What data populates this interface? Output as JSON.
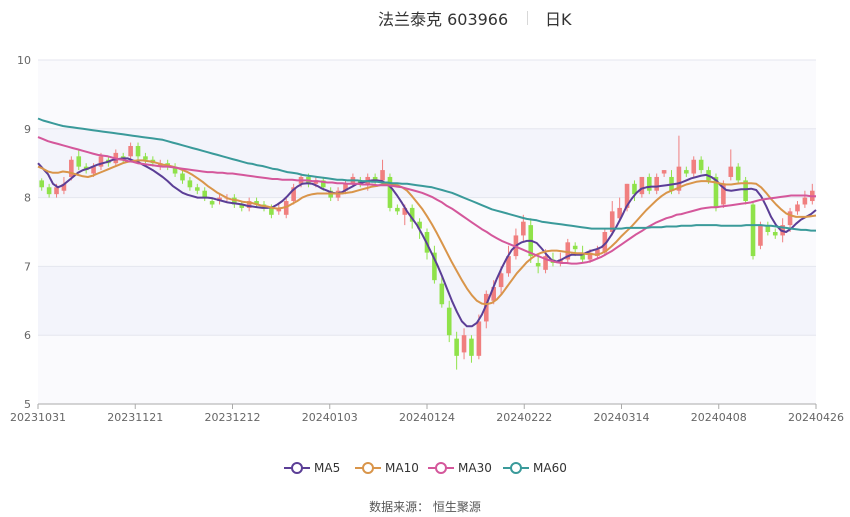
{
  "header": {
    "name": "法兰泰克 603966",
    "period": "日K"
  },
  "source": {
    "label": "数据来源：",
    "value": "恒生聚源"
  },
  "legend": [
    {
      "key": "ma5",
      "label": "MA5",
      "color": "#5b3e96"
    },
    {
      "key": "ma10",
      "label": "MA10",
      "color": "#d9954a"
    },
    {
      "key": "ma30",
      "label": "MA30",
      "color": "#d4579b"
    },
    {
      "key": "ma60",
      "label": "MA60",
      "color": "#3a9a9a"
    }
  ],
  "chart_data": {
    "type": "candlestick",
    "ylim": [
      5,
      10
    ],
    "yticks": [
      5,
      6,
      7,
      8,
      9,
      10
    ],
    "xtick_labels": [
      "20231031",
      "20231121",
      "20231212",
      "20240103",
      "20240124",
      "20240222",
      "20240314",
      "20240408",
      "20240426"
    ],
    "colors": {
      "up": "#f07f7f",
      "down": "#8fe24a"
    },
    "candles": [
      [
        8.25,
        8.15,
        8.28,
        8.1
      ],
      [
        8.15,
        8.05,
        8.2,
        8.0
      ],
      [
        8.05,
        8.15,
        8.2,
        8.0
      ],
      [
        8.1,
        8.2,
        8.3,
        8.05
      ],
      [
        8.3,
        8.55,
        8.6,
        8.25
      ],
      [
        8.6,
        8.45,
        8.7,
        8.4
      ],
      [
        8.45,
        8.4,
        8.5,
        8.35
      ],
      [
        8.35,
        8.45,
        8.5,
        8.3
      ],
      [
        8.45,
        8.6,
        8.65,
        8.4
      ],
      [
        8.55,
        8.5,
        8.6,
        8.45
      ],
      [
        8.5,
        8.65,
        8.7,
        8.45
      ],
      [
        8.6,
        8.55,
        8.65,
        8.5
      ],
      [
        8.6,
        8.75,
        8.8,
        8.55
      ],
      [
        8.75,
        8.6,
        8.8,
        8.55
      ],
      [
        8.6,
        8.55,
        8.65,
        8.5
      ],
      [
        8.55,
        8.5,
        8.6,
        8.45
      ],
      [
        8.45,
        8.5,
        8.55,
        8.4
      ],
      [
        8.5,
        8.45,
        8.55,
        8.4
      ],
      [
        8.45,
        8.35,
        8.5,
        8.3
      ],
      [
        8.35,
        8.25,
        8.4,
        8.2
      ],
      [
        8.25,
        8.15,
        8.3,
        8.1
      ],
      [
        8.15,
        8.1,
        8.2,
        8.05
      ],
      [
        8.1,
        8.0,
        8.15,
        7.95
      ],
      [
        7.95,
        7.9,
        8.0,
        7.85
      ],
      [
        7.95,
        8.0,
        8.05,
        7.9
      ],
      [
        8.0,
        8.0,
        8.05,
        7.95
      ],
      [
        8.0,
        7.9,
        8.05,
        7.85
      ],
      [
        7.9,
        7.85,
        7.95,
        7.8
      ],
      [
        7.85,
        7.95,
        8.0,
        7.8
      ],
      [
        7.95,
        7.9,
        8.0,
        7.85
      ],
      [
        7.9,
        7.85,
        7.95,
        7.8
      ],
      [
        7.85,
        7.75,
        7.9,
        7.7
      ],
      [
        7.8,
        7.85,
        7.9,
        7.75
      ],
      [
        7.75,
        7.95,
        8.0,
        7.7
      ],
      [
        7.95,
        8.15,
        8.2,
        7.9
      ],
      [
        8.2,
        8.3,
        8.35,
        8.15
      ],
      [
        8.3,
        8.2,
        8.35,
        8.15
      ],
      [
        8.2,
        8.25,
        8.3,
        8.15
      ],
      [
        8.25,
        8.15,
        8.3,
        8.1
      ],
      [
        8.1,
        8.0,
        8.15,
        7.95
      ],
      [
        8.0,
        8.1,
        8.15,
        7.95
      ],
      [
        8.1,
        8.2,
        8.25,
        8.05
      ],
      [
        8.2,
        8.3,
        8.35,
        8.15
      ],
      [
        8.25,
        8.2,
        8.3,
        8.15
      ],
      [
        8.2,
        8.3,
        8.35,
        8.1
      ],
      [
        8.3,
        8.25,
        8.35,
        8.2
      ],
      [
        8.25,
        8.4,
        8.55,
        8.2
      ],
      [
        8.3,
        7.85,
        8.35,
        7.8
      ],
      [
        7.85,
        7.8,
        7.9,
        7.75
      ],
      [
        7.75,
        7.85,
        7.9,
        7.6
      ],
      [
        7.85,
        7.65,
        7.9,
        7.55
      ],
      [
        7.65,
        7.55,
        7.7,
        7.4
      ],
      [
        7.5,
        7.2,
        7.55,
        7.1
      ],
      [
        7.2,
        6.8,
        7.3,
        6.75
      ],
      [
        6.75,
        6.45,
        6.85,
        6.4
      ],
      [
        6.4,
        6.0,
        6.5,
        5.9
      ],
      [
        5.95,
        5.7,
        6.05,
        5.5
      ],
      [
        5.75,
        6.0,
        6.1,
        5.65
      ],
      [
        5.95,
        5.7,
        6.0,
        5.6
      ],
      [
        5.7,
        6.2,
        6.3,
        5.65
      ],
      [
        6.2,
        6.6,
        6.65,
        6.1
      ],
      [
        6.5,
        6.7,
        6.8,
        6.45
      ],
      [
        6.7,
        6.9,
        7.0,
        6.6
      ],
      [
        6.9,
        7.15,
        7.3,
        6.85
      ],
      [
        7.15,
        7.45,
        7.55,
        7.1
      ],
      [
        7.45,
        7.65,
        7.75,
        7.35
      ],
      [
        7.6,
        7.15,
        7.7,
        7.05
      ],
      [
        7.05,
        7.0,
        7.15,
        6.9
      ],
      [
        6.95,
        7.15,
        7.25,
        6.9
      ],
      [
        7.1,
        7.05,
        7.2,
        7.0
      ],
      [
        7.05,
        7.1,
        7.2,
        7.0
      ],
      [
        7.1,
        7.35,
        7.4,
        7.05
      ],
      [
        7.3,
        7.25,
        7.35,
        7.15
      ],
      [
        7.2,
        7.1,
        7.3,
        7.05
      ],
      [
        7.1,
        7.2,
        7.25,
        7.05
      ],
      [
        7.15,
        7.25,
        7.3,
        7.1
      ],
      [
        7.2,
        7.5,
        7.55,
        7.15
      ],
      [
        7.5,
        7.8,
        7.95,
        7.45
      ],
      [
        7.7,
        7.85,
        8.0,
        7.65
      ],
      [
        7.85,
        8.2,
        8.2,
        7.8
      ],
      [
        8.2,
        8.05,
        8.25,
        7.95
      ],
      [
        8.05,
        8.3,
        8.3,
        8.0
      ],
      [
        8.3,
        8.1,
        8.35,
        8.05
      ],
      [
        8.1,
        8.3,
        8.35,
        8.05
      ],
      [
        8.35,
        8.4,
        8.4,
        8.3
      ],
      [
        8.3,
        8.1,
        8.4,
        8.05
      ],
      [
        8.1,
        8.45,
        8.9,
        8.05
      ],
      [
        8.4,
        8.35,
        8.45,
        8.3
      ],
      [
        8.35,
        8.55,
        8.6,
        8.3
      ],
      [
        8.55,
        8.4,
        8.6,
        8.35
      ],
      [
        8.4,
        8.25,
        8.45,
        8.2
      ],
      [
        8.3,
        7.85,
        8.35,
        7.8
      ],
      [
        7.9,
        8.2,
        8.25,
        7.85
      ],
      [
        8.3,
        8.45,
        8.7,
        8.25
      ],
      [
        8.45,
        8.25,
        8.5,
        8.2
      ],
      [
        8.25,
        7.95,
        8.3,
        7.9
      ],
      [
        7.9,
        7.15,
        7.95,
        7.1
      ],
      [
        7.3,
        7.6,
        7.65,
        7.25
      ],
      [
        7.6,
        7.5,
        7.65,
        7.45
      ],
      [
        7.5,
        7.45,
        7.55,
        7.4
      ],
      [
        7.45,
        7.6,
        7.7,
        7.35
      ],
      [
        7.6,
        7.8,
        7.85,
        7.5
      ],
      [
        7.8,
        7.9,
        7.95,
        7.75
      ],
      [
        7.9,
        8.0,
        8.1,
        7.85
      ],
      [
        7.95,
        8.1,
        8.2,
        7.9
      ]
    ],
    "series": [
      {
        "name": "MA5",
        "values": [
          8.5,
          8.42,
          8.34,
          8.2,
          8.15,
          8.18,
          8.24,
          8.3,
          8.36,
          8.4,
          8.42,
          8.45,
          8.48,
          8.5,
          8.52,
          8.55,
          8.56,
          8.57,
          8.57,
          8.54,
          8.52,
          8.48,
          8.44,
          8.4,
          8.35,
          8.3,
          8.24,
          8.17,
          8.12,
          8.07,
          8.04,
          8.02,
          8.0,
          8.0,
          8.0,
          7.99,
          7.97,
          7.95,
          7.93,
          7.92,
          7.91,
          7.9,
          7.88,
          7.87,
          7.86,
          7.85,
          7.85,
          7.86,
          7.9,
          7.95,
          8.02,
          8.1,
          8.16,
          8.2,
          8.21,
          8.2,
          8.17,
          8.13,
          8.1,
          8.07,
          8.06,
          8.08,
          8.12,
          8.16,
          8.2,
          8.22,
          8.24,
          8.25,
          8.25,
          8.24,
          8.2,
          8.13,
          8.03,
          7.92,
          7.8,
          7.7,
          7.6,
          7.47,
          7.33,
          7.18,
          7.03,
          6.86,
          6.68,
          6.5,
          6.34,
          6.2,
          6.13,
          6.13,
          6.18,
          6.3,
          6.46,
          6.64,
          6.82,
          6.98,
          7.12,
          7.24,
          7.31,
          7.35,
          7.37,
          7.37,
          7.34,
          7.26,
          7.17,
          7.09,
          7.07,
          7.1,
          7.14,
          7.17,
          7.17,
          7.17,
          7.2,
          7.23,
          7.25,
          7.28,
          7.35,
          7.46,
          7.58,
          7.72,
          7.87,
          7.98,
          8.07,
          8.13,
          8.15,
          8.16,
          8.16,
          8.17,
          8.18,
          8.19,
          8.2,
          8.22,
          8.25,
          8.28,
          8.3,
          8.32,
          8.33,
          8.3,
          8.25,
          8.17,
          8.11,
          8.1,
          8.11,
          8.12,
          8.12,
          8.13,
          8.11,
          8.02,
          7.88,
          7.72,
          7.6,
          7.52,
          7.5,
          7.55,
          7.62,
          7.68,
          7.72,
          7.76,
          7.82
        ]
      },
      {
        "name": "MA10",
        "values": [
          8.45,
          8.42,
          8.38,
          8.36,
          8.36,
          8.38,
          8.37,
          8.35,
          8.33,
          8.31,
          8.3,
          8.32,
          8.35,
          8.38,
          8.41,
          8.44,
          8.47,
          8.5,
          8.52,
          8.53,
          8.54,
          8.54,
          8.53,
          8.52,
          8.5,
          8.48,
          8.47,
          8.45,
          8.43,
          8.4,
          8.37,
          8.33,
          8.28,
          8.23,
          8.17,
          8.12,
          8.07,
          8.03,
          7.99,
          7.97,
          7.96,
          7.94,
          7.93,
          7.92,
          7.9,
          7.88,
          7.87,
          7.85,
          7.84,
          7.85,
          7.87,
          7.91,
          7.95,
          8.0,
          8.03,
          8.05,
          8.06,
          8.06,
          8.06,
          8.06,
          8.06,
          8.06,
          8.07,
          8.08,
          8.1,
          8.12,
          8.14,
          8.16,
          8.17,
          8.19,
          8.19,
          8.19,
          8.18,
          8.15,
          8.1,
          8.02,
          7.93,
          7.84,
          7.73,
          7.61,
          7.48,
          7.34,
          7.2,
          7.06,
          6.93,
          6.8,
          6.68,
          6.58,
          6.5,
          6.46,
          6.45,
          6.47,
          6.52,
          6.6,
          6.7,
          6.8,
          6.9,
          6.98,
          7.06,
          7.12,
          7.17,
          7.2,
          7.22,
          7.23,
          7.23,
          7.22,
          7.21,
          7.2,
          7.19,
          7.19,
          7.18,
          7.18,
          7.17,
          7.19,
          7.23,
          7.29,
          7.36,
          7.44,
          7.51,
          7.58,
          7.66,
          7.74,
          7.82,
          7.89,
          7.96,
          8.02,
          8.07,
          8.1,
          8.13,
          8.16,
          8.19,
          8.21,
          8.23,
          8.24,
          8.24,
          8.23,
          8.22,
          8.2,
          8.19,
          8.19,
          8.2,
          8.21,
          8.21,
          8.21,
          8.2,
          8.15,
          8.07,
          7.98,
          7.9,
          7.83,
          7.77,
          7.74,
          7.72,
          7.72,
          7.72,
          7.73,
          7.74
        ]
      },
      {
        "name": "MA30",
        "values": [
          8.88,
          8.85,
          8.82,
          8.8,
          8.78,
          8.76,
          8.74,
          8.72,
          8.7,
          8.68,
          8.66,
          8.64,
          8.62,
          8.61,
          8.6,
          8.58,
          8.56,
          8.55,
          8.53,
          8.52,
          8.5,
          8.49,
          8.48,
          8.47,
          8.46,
          8.45,
          8.45,
          8.44,
          8.43,
          8.42,
          8.41,
          8.4,
          8.39,
          8.38,
          8.37,
          8.37,
          8.36,
          8.36,
          8.35,
          8.35,
          8.34,
          8.33,
          8.32,
          8.31,
          8.3,
          8.29,
          8.28,
          8.27,
          8.27,
          8.26,
          8.26,
          8.26,
          8.25,
          8.25,
          8.25,
          8.24,
          8.24,
          8.23,
          8.22,
          8.22,
          8.21,
          8.21,
          8.2,
          8.2,
          8.2,
          8.19,
          8.19,
          8.19,
          8.18,
          8.18,
          8.18,
          8.17,
          8.16,
          8.15,
          8.13,
          8.11,
          8.09,
          8.07,
          8.04,
          8.01,
          7.97,
          7.93,
          7.88,
          7.84,
          7.79,
          7.74,
          7.69,
          7.64,
          7.59,
          7.54,
          7.5,
          7.45,
          7.41,
          7.37,
          7.34,
          7.31,
          7.28,
          7.25,
          7.22,
          7.19,
          7.16,
          7.13,
          7.1,
          7.08,
          7.06,
          7.05,
          7.05,
          7.04,
          7.04,
          7.05,
          7.06,
          7.08,
          7.11,
          7.14,
          7.18,
          7.22,
          7.27,
          7.32,
          7.37,
          7.42,
          7.47,
          7.51,
          7.56,
          7.6,
          7.64,
          7.67,
          7.7,
          7.72,
          7.75,
          7.76,
          7.78,
          7.8,
          7.82,
          7.84,
          7.85,
          7.86,
          7.86,
          7.87,
          7.88,
          7.89,
          7.9,
          7.91,
          7.92,
          7.93,
          7.95,
          7.97,
          7.98,
          7.99,
          8.0,
          8.01,
          8.02,
          8.03,
          8.03,
          8.03,
          8.03,
          8.02,
          8.02
        ]
      },
      {
        "name": "MA60",
        "values": [
          9.15,
          9.12,
          9.1,
          9.08,
          9.06,
          9.04,
          9.03,
          9.02,
          9.01,
          9.0,
          8.99,
          8.98,
          8.97,
          8.96,
          8.95,
          8.94,
          8.93,
          8.92,
          8.91,
          8.9,
          8.89,
          8.88,
          8.87,
          8.86,
          8.85,
          8.84,
          8.82,
          8.8,
          8.78,
          8.76,
          8.74,
          8.72,
          8.7,
          8.68,
          8.66,
          8.64,
          8.62,
          8.6,
          8.58,
          8.56,
          8.54,
          8.52,
          8.5,
          8.49,
          8.47,
          8.46,
          8.44,
          8.42,
          8.41,
          8.39,
          8.37,
          8.36,
          8.35,
          8.33,
          8.32,
          8.31,
          8.3,
          8.29,
          8.28,
          8.27,
          8.26,
          8.26,
          8.25,
          8.25,
          8.25,
          8.24,
          8.24,
          8.23,
          8.23,
          8.22,
          8.22,
          8.21,
          8.21,
          8.2,
          8.2,
          8.19,
          8.18,
          8.17,
          8.16,
          8.15,
          8.13,
          8.11,
          8.09,
          8.07,
          8.04,
          8.01,
          7.98,
          7.95,
          7.92,
          7.89,
          7.86,
          7.83,
          7.81,
          7.79,
          7.77,
          7.75,
          7.73,
          7.71,
          7.69,
          7.68,
          7.67,
          7.65,
          7.64,
          7.63,
          7.62,
          7.61,
          7.6,
          7.59,
          7.58,
          7.57,
          7.56,
          7.55,
          7.55,
          7.55,
          7.55,
          7.55,
          7.55,
          7.55,
          7.56,
          7.56,
          7.56,
          7.56,
          7.56,
          7.57,
          7.57,
          7.57,
          7.58,
          7.58,
          7.58,
          7.59,
          7.59,
          7.59,
          7.6,
          7.6,
          7.6,
          7.6,
          7.6,
          7.59,
          7.59,
          7.59,
          7.59,
          7.59,
          7.6,
          7.6,
          7.6,
          7.6,
          7.59,
          7.59,
          7.58,
          7.57,
          7.56,
          7.55,
          7.54,
          7.53,
          7.53,
          7.52,
          7.52
        ]
      }
    ]
  }
}
